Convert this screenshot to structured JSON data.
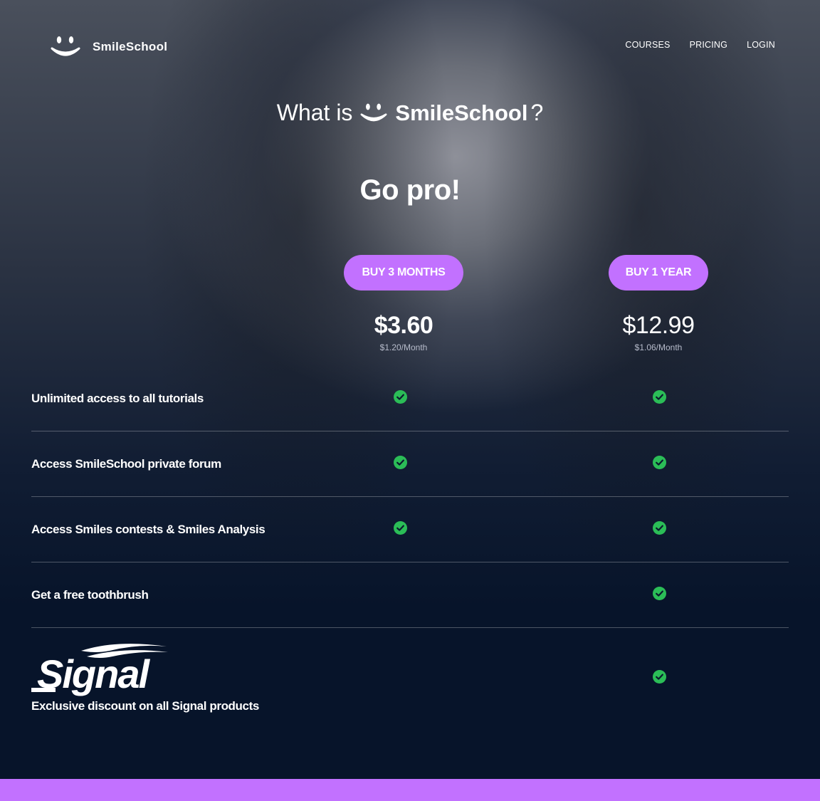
{
  "brand": {
    "name": "SmileSchool"
  },
  "nav": {
    "items": [
      {
        "label": "COURSES"
      },
      {
        "label": "PRICING"
      },
      {
        "label": "LOGIN"
      }
    ]
  },
  "hero": {
    "what_prefix": "What is",
    "what_brand": "SmileSchool",
    "what_suffix": "?",
    "headline": "Go pro!"
  },
  "plans": [
    {
      "button": "BUY 3 MONTHS",
      "price": "$3.60",
      "per_month": "$1.20/Month"
    },
    {
      "button": "BUY 1 YEAR",
      "price": "$12.99",
      "per_month": "$1.06/Month"
    }
  ],
  "features": [
    {
      "label": "Unlimited access to all tutorials",
      "plan_3m": true,
      "plan_1y": true
    },
    {
      "label": "Access SmileSchool private forum",
      "plan_3m": true,
      "plan_1y": true
    },
    {
      "label": "Access Smiles contests & Smiles Analysis",
      "plan_3m": true,
      "plan_1y": true
    },
    {
      "label": "Get a free toothbrush",
      "plan_3m": false,
      "plan_1y": true
    },
    {
      "label": "Exclusive discount on all Signal products",
      "partner_logo_text": "Signal",
      "plan_3m": false,
      "plan_1y": true
    }
  ],
  "colors": {
    "accent": "#c271ff",
    "check": "#2bbd57",
    "background": "#07142a"
  },
  "icons": {
    "logo": "smile-icon",
    "check": "check-circle-icon"
  }
}
